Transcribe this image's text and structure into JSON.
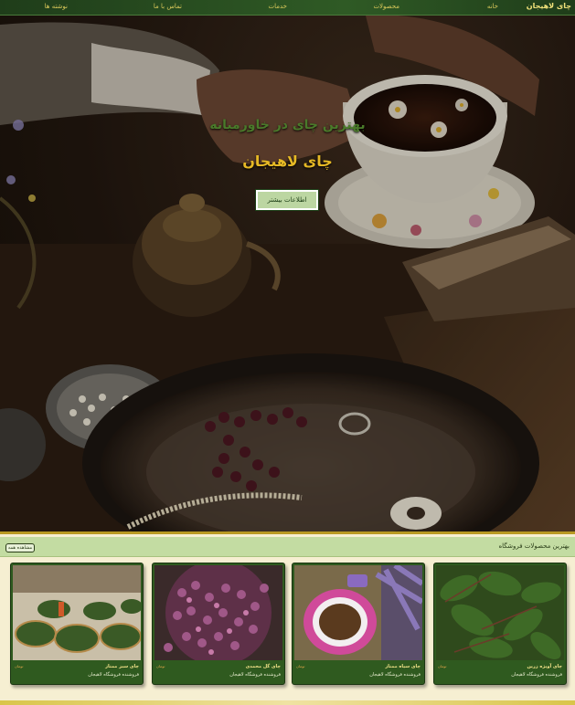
{
  "nav": {
    "brand": "چای لاهیجان",
    "items": [
      "خانه",
      "محصولات",
      "خدمات",
      "تماس با ما",
      "نوشته ها"
    ]
  },
  "hero": {
    "subtitle": "بهترین چای در خاورمیانه",
    "title": "چای لاهیجان",
    "button": "اطلاعات بیشتر"
  },
  "products": {
    "heading": "بهترین محصولات فروشگاه",
    "view_all": "مشاهده همه",
    "cards": [
      {
        "name": "چای آویژه زرین",
        "shop": "فروشنده فروشگاه لاهیجان",
        "price": "تومان",
        "image": "tea-leaves"
      },
      {
        "name": "چای سیاه ممتاز",
        "shop": "فروشنده فروشگاه لاهیجان",
        "price": "تومان",
        "image": "tea-cup"
      },
      {
        "name": "چای گل محمدی",
        "shop": "فروشنده فروشگاه لاهیجان",
        "price": "تومان",
        "image": "rose-buds"
      },
      {
        "name": "چای سبز ممتاز",
        "shop": "فروشنده فروشگاه لاهیجان",
        "price": "تومان",
        "image": "tea-factory"
      }
    ]
  },
  "colors": {
    "accent": "#e6b925",
    "nav": "#2f5a25",
    "card": "#2f5a1f"
  }
}
